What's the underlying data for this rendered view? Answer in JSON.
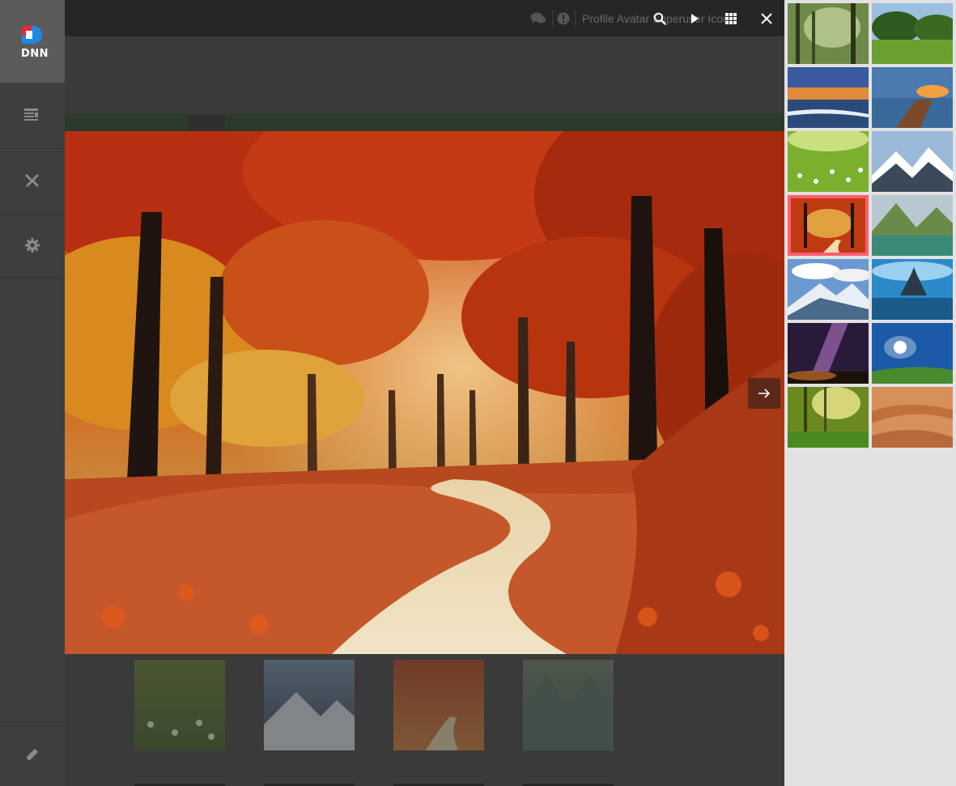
{
  "page": {
    "title": "Profile Avatar Superuser Icon"
  },
  "sidebar": {
    "logo_text": "DNN",
    "items": [
      {
        "name": "content",
        "icon": "content-icon"
      },
      {
        "name": "tools",
        "icon": "tools-icon"
      },
      {
        "name": "settings",
        "icon": "gear-icon"
      }
    ],
    "edit_icon": "pencil-icon"
  },
  "lightbox": {
    "toolbar": {
      "icons": [
        "comments-icon",
        "info-icon",
        "search-icon",
        "play-icon",
        "grid-icon",
        "close-icon"
      ]
    },
    "current_image": "Autumn forest path",
    "next_icon": "arrow-right-icon",
    "thumbnails": [
      {
        "name": "Misty forest"
      },
      {
        "name": "Park meadow"
      },
      {
        "name": "Sunset beach"
      },
      {
        "name": "Lake pier"
      },
      {
        "name": "Spring flowers"
      },
      {
        "name": "Snowy mountains"
      },
      {
        "name": "Autumn forest path",
        "active": true
      },
      {
        "name": "Mountain lake"
      },
      {
        "name": "Mountain clouds"
      },
      {
        "name": "Mont Saint-Michel"
      },
      {
        "name": "Milky way"
      },
      {
        "name": "Sun over hills"
      },
      {
        "name": "Sunlit forest"
      },
      {
        "name": "Desert dunes"
      }
    ]
  },
  "gallery": {
    "background_thumbnails": [
      "Spring flowers",
      "Snowy mountains",
      "Autumn forest path",
      "Mountain lake"
    ]
  },
  "colors": {
    "active_thumb_border": "#ff5d70",
    "panel_bg": "#e2e2e2",
    "sidebar_bg": "#3e3e3e"
  }
}
